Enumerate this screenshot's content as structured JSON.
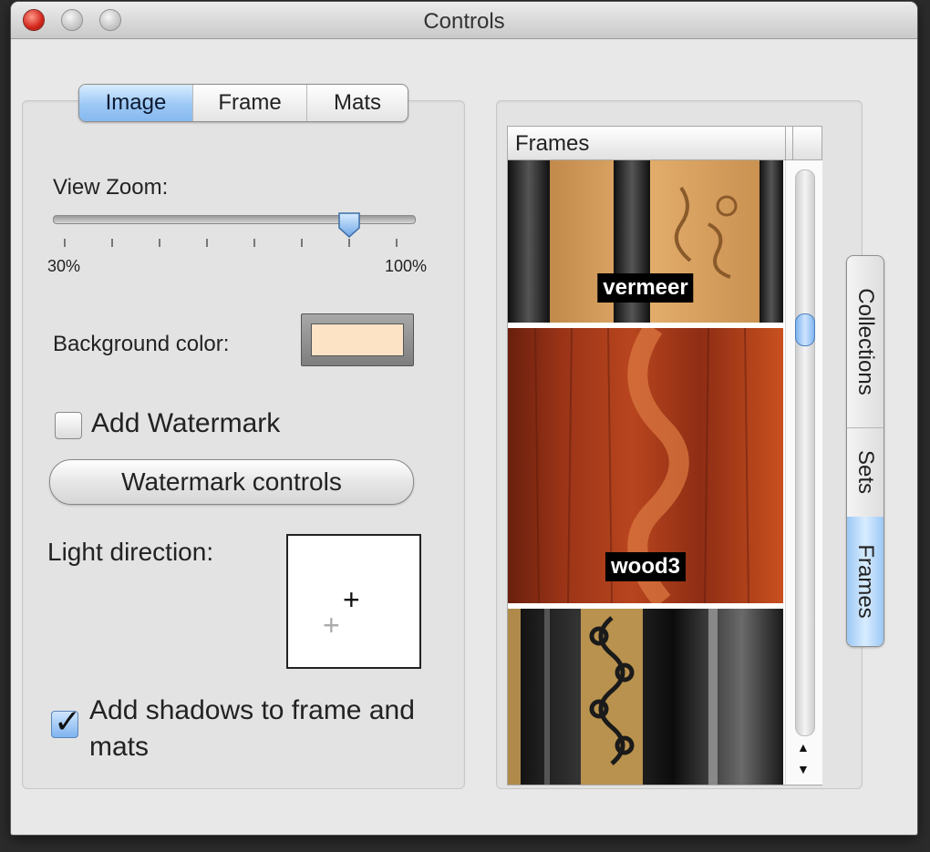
{
  "window": {
    "title": "Controls"
  },
  "tabs": [
    {
      "label": "Image",
      "active": true
    },
    {
      "label": "Frame",
      "active": false
    },
    {
      "label": "Mats",
      "active": false
    }
  ],
  "zoom": {
    "label": "View Zoom:",
    "min_label": "30%",
    "max_label": "100%",
    "value_fraction": 0.82
  },
  "background": {
    "label": "Background color:",
    "color": "#fde3c6"
  },
  "watermark": {
    "checkbox_label": "Add Watermark",
    "checked": false,
    "button_label": "Watermark controls"
  },
  "light": {
    "label": "Light direction:"
  },
  "shadows": {
    "label": "Add shadows to frame and mats",
    "checked": true
  },
  "frames_list": {
    "header": "Frames",
    "items": [
      {
        "name": "vermeer",
        "style": "gold-carved"
      },
      {
        "name": "wood3",
        "style": "cherry-wood"
      },
      {
        "name": "",
        "style": "black-gold-ornate"
      }
    ],
    "scroll_fraction": 0.27
  },
  "side_tabs": [
    {
      "label": "Collections",
      "active": false
    },
    {
      "label": "Sets",
      "active": false
    },
    {
      "label": "Frames",
      "active": true
    }
  ],
  "colors": {
    "accent": "#86b9ef",
    "swatch": "#fde3c6"
  }
}
